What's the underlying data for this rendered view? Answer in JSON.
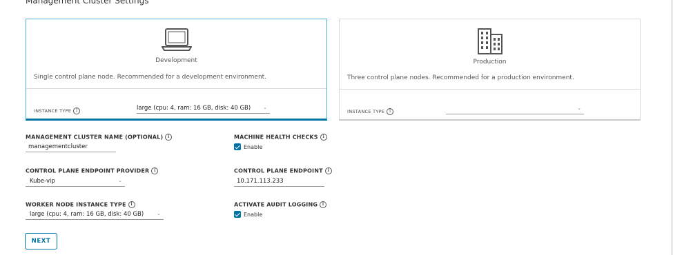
{
  "section": {
    "title": "Management Cluster Settings"
  },
  "cards": [
    {
      "title": "Development",
      "description": "Single control plane node. Recommended for a development environment.",
      "instance_type_label": "INSTANCE TYPE",
      "instance_type_value": "large (cpu: 4, ram: 16 GB, disk: 40 GB)",
      "icon": "laptop-icon",
      "selected": true
    },
    {
      "title": "Production",
      "description": "Three control plane nodes. Recommended for a production environment.",
      "instance_type_label": "INSTANCE TYPE",
      "instance_type_value": "",
      "icon": "building-icon",
      "selected": false
    }
  ],
  "fields": {
    "cluster_name": {
      "label": "MANAGEMENT CLUSTER NAME (OPTIONAL)",
      "value": "managementcluster"
    },
    "machine_health": {
      "label": "MACHINE HEALTH CHECKS",
      "checkbox_label": "Enable",
      "checked": true
    },
    "endpoint_provider": {
      "label": "CONTROL PLANE ENDPOINT PROVIDER",
      "value": "Kube-vip"
    },
    "endpoint": {
      "label": "CONTROL PLANE ENDPOINT",
      "value": "10.171.113.233"
    },
    "worker_instance": {
      "label": "WORKER NODE INSTANCE TYPE",
      "value": "large (cpu: 4, ram: 16 GB, disk: 40 GB)"
    },
    "audit_logging": {
      "label": "ACTIVATE AUDIT LOGGING",
      "checkbox_label": "Enable",
      "checked": true
    }
  },
  "buttons": {
    "next": "NEXT"
  },
  "colors": {
    "accent": "#0072a3",
    "selected_border": "#49afd9"
  }
}
